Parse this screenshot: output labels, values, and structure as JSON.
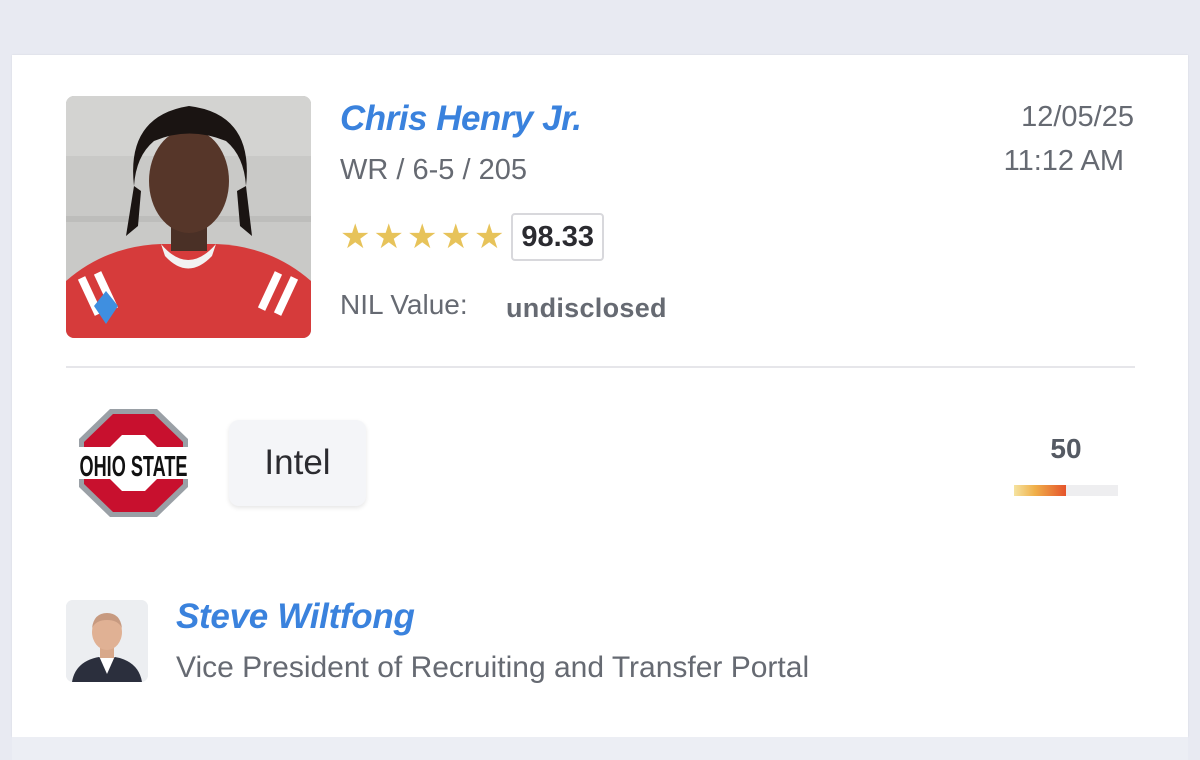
{
  "player": {
    "name": "Chris Henry Jr.",
    "meta": "WR / 6-5 / 205",
    "star_count": 5,
    "rating": "98.33",
    "nil_label": "NIL Value:",
    "nil_value": "undisclosed"
  },
  "timestamp": {
    "date": "12/05/25",
    "time": "11:12 AM"
  },
  "school": {
    "logo_icon": "ohio-state-block-o-logo",
    "logo_text": "OHIO STATE"
  },
  "intel_button": {
    "label": "Intel"
  },
  "score": {
    "value": "50",
    "fraction": 0.5
  },
  "author": {
    "name": "Steve Wiltfong",
    "title": "Vice President of Recruiting and Transfer Portal"
  },
  "colors": {
    "accent_blue": "#3a82dd",
    "star_gold": "#e7c35a",
    "scarlet": "#c8102e"
  }
}
